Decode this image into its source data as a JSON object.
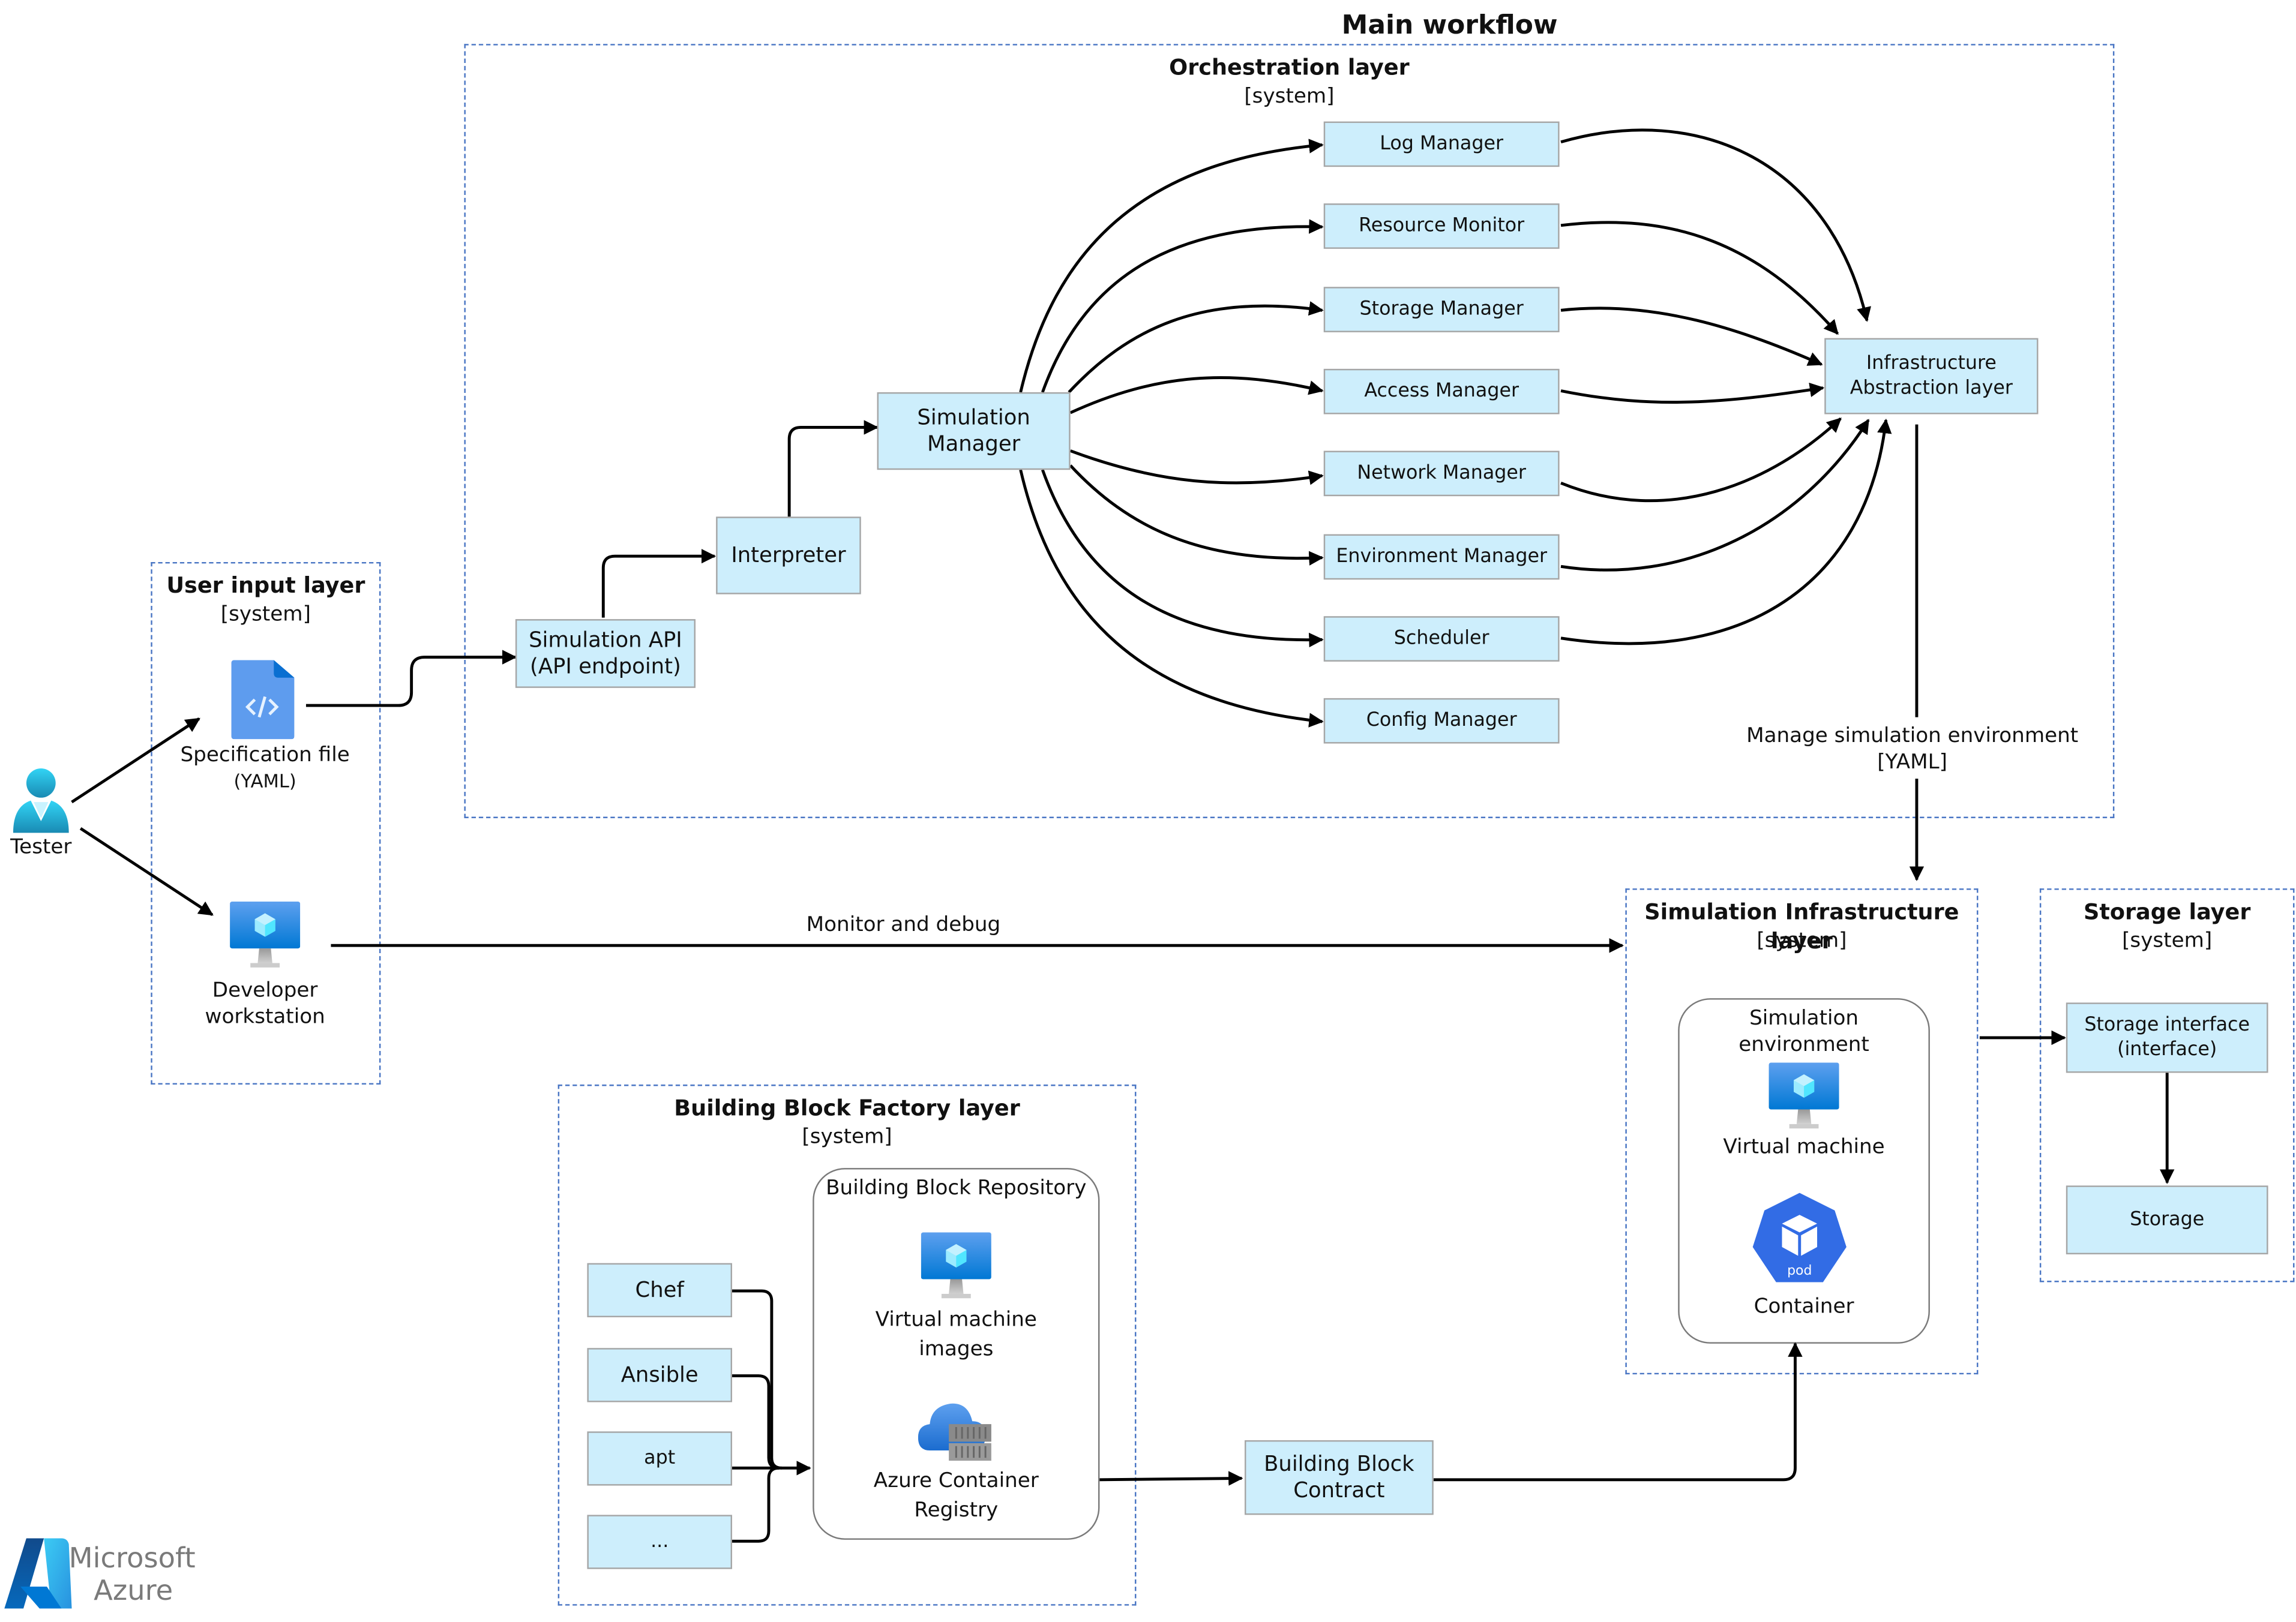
{
  "title": "Main workflow",
  "layers": {
    "orchestration": {
      "title": "Orchestration layer",
      "subtitle": "[system]"
    },
    "user_input": {
      "title": "User input layer",
      "subtitle": "[system]"
    },
    "simulation_infrastructure": {
      "title": "Simulation Infrastructure layer",
      "subtitle": "[system]"
    },
    "storage": {
      "title": "Storage layer",
      "subtitle": "[system]"
    },
    "building_block_factory": {
      "title": "Building Block Factory layer",
      "subtitle": "[system]"
    }
  },
  "actors": {
    "tester": "Tester",
    "spec_file": {
      "line1": "Specification file",
      "line2": "(YAML)"
    },
    "dev_workstation": {
      "line1": "Developer",
      "line2": "workstation"
    }
  },
  "orchestration": {
    "simulation_api": {
      "line1": "Simulation API",
      "line2": "(API endpoint)"
    },
    "interpreter": "Interpreter",
    "simulation_manager": {
      "line1": "Simulation",
      "line2": "Manager"
    },
    "managers": [
      "Log Manager",
      "Resource Monitor",
      "Storage Manager",
      "Access Manager",
      "Network Manager",
      "Environment Manager",
      "Scheduler",
      "Config Manager"
    ],
    "infra_abstraction": {
      "line1": "Infrastructure",
      "line2": "Abstraction layer"
    }
  },
  "edges": {
    "manage_env": {
      "line1": "Manage simulation environment",
      "line2": "[YAML]"
    },
    "monitor_debug": "Monitor and debug"
  },
  "sim_infra": {
    "env_title": {
      "line1": "Simulation",
      "line2": "environment"
    },
    "vm": "Virtual machine",
    "container": "Container",
    "pod": "pod"
  },
  "storage": {
    "interface": {
      "line1": "Storage interface",
      "line2": "(interface)"
    },
    "storage": "Storage"
  },
  "factory": {
    "tools": [
      "Chef",
      "Ansible",
      "apt",
      "..."
    ],
    "repository_title": "Building Block Repository",
    "vm_images": {
      "line1": "Virtual machine",
      "line2": "images"
    },
    "acr": {
      "line1": "Azure Container",
      "line2": "Registry"
    },
    "contract": {
      "line1": "Building Block",
      "line2": "Contract"
    }
  },
  "logo": {
    "line1": "Microsoft",
    "line2": "Azure"
  },
  "colors": {
    "box_fill": "#cdeefc",
    "box_border": "#a6a6a6",
    "layer_border": "#4a76c4",
    "azure_blue": "#0078d4",
    "k8s_blue": "#326ce5"
  }
}
